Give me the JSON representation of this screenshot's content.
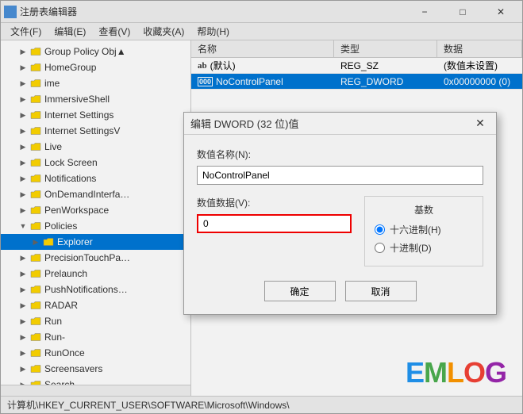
{
  "window": {
    "title": "注册表编辑器",
    "icon": "reg"
  },
  "menu": {
    "items": [
      "文件(F)",
      "编辑(E)",
      "查看(V)",
      "收藏夹(A)",
      "帮助(H)"
    ]
  },
  "tree": {
    "items": [
      {
        "label": "Group Policy Obj▲",
        "indent": 1,
        "expanded": false,
        "selected": false
      },
      {
        "label": "HomeGroup",
        "indent": 1,
        "expanded": false,
        "selected": false
      },
      {
        "label": "ime",
        "indent": 1,
        "expanded": false,
        "selected": false
      },
      {
        "label": "ImmersiveShell",
        "indent": 1,
        "expanded": false,
        "selected": false
      },
      {
        "label": "Internet Settings",
        "indent": 1,
        "expanded": false,
        "selected": false
      },
      {
        "label": "Internet SettingsV",
        "indent": 1,
        "expanded": false,
        "selected": false
      },
      {
        "label": "Live",
        "indent": 1,
        "expanded": false,
        "selected": false
      },
      {
        "label": "Lock Screen",
        "indent": 1,
        "expanded": false,
        "selected": false
      },
      {
        "label": "Notifications",
        "indent": 1,
        "expanded": false,
        "selected": false
      },
      {
        "label": "OnDemandInterfa…",
        "indent": 1,
        "expanded": false,
        "selected": false
      },
      {
        "label": "PenWorkspace",
        "indent": 1,
        "expanded": false,
        "selected": false
      },
      {
        "label": "Policies",
        "indent": 1,
        "expanded": true,
        "selected": false
      },
      {
        "label": "Explorer",
        "indent": 2,
        "expanded": false,
        "selected": true
      },
      {
        "label": "PrecisionTouchPa…",
        "indent": 1,
        "expanded": false,
        "selected": false
      },
      {
        "label": "Prelaunch",
        "indent": 1,
        "expanded": false,
        "selected": false
      },
      {
        "label": "PushNotifications…",
        "indent": 1,
        "expanded": false,
        "selected": false
      },
      {
        "label": "RADAR",
        "indent": 1,
        "expanded": false,
        "selected": false
      },
      {
        "label": "Run",
        "indent": 1,
        "expanded": false,
        "selected": false
      },
      {
        "label": "Run-",
        "indent": 1,
        "expanded": false,
        "selected": false
      },
      {
        "label": "RunOnce",
        "indent": 1,
        "expanded": false,
        "selected": false
      },
      {
        "label": "Screensavers",
        "indent": 1,
        "expanded": false,
        "selected": false
      },
      {
        "label": "Search",
        "indent": 1,
        "expanded": false,
        "selected": false
      }
    ]
  },
  "table": {
    "headers": [
      "名称",
      "类型",
      "数据"
    ],
    "rows": [
      {
        "icon": "ab",
        "name": "(默认)",
        "type": "REG_SZ",
        "data": "(数值未设置)",
        "selected": false
      },
      {
        "icon": "dword",
        "name": "NoControlPanel",
        "type": "REG_DWORD",
        "data": "0x00000000 (0)",
        "selected": true
      }
    ]
  },
  "dialog": {
    "title": "编辑 DWORD (32 位)值",
    "value_name_label": "数值名称(N):",
    "value_name": "NoControlPanel",
    "value_data_label": "数值数据(V):",
    "value_data": "0",
    "base_label": "基数",
    "radio_hex_label": "● 十六进制(H)",
    "radio_dec_label": "○ 十进制(D)",
    "hex_selected": true,
    "ok_label": "确定",
    "cancel_label": "取消"
  },
  "status_bar": {
    "text": "计算机\\HKEY_CURRENT_USER\\SOFTWARE\\Microsoft\\Windows\\"
  },
  "watermark": {
    "e": "E",
    "m": "M",
    "l": "L",
    "o": "O",
    "g": "G"
  }
}
